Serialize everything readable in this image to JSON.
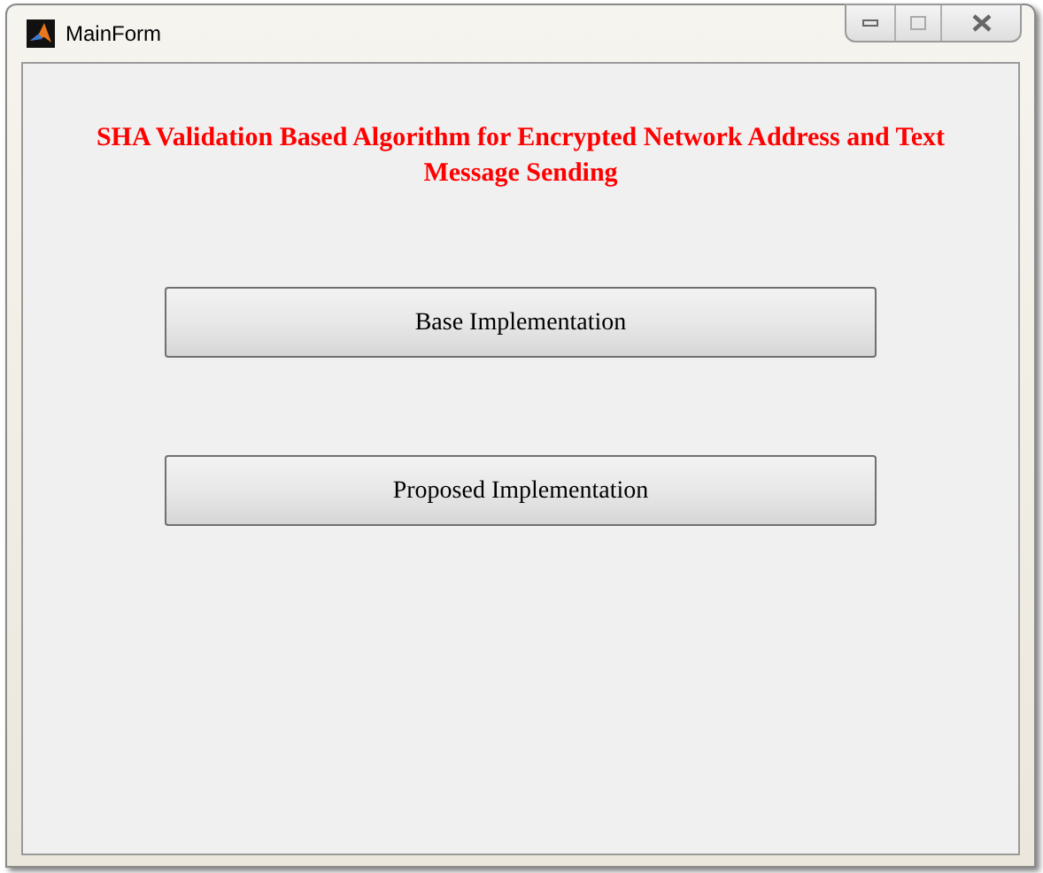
{
  "window": {
    "title": "MainForm"
  },
  "heading": "SHA Validation Based Algorithm for Encrypted Network Address and Text Message Sending",
  "buttons": [
    {
      "label": "Base Implementation"
    },
    {
      "label": "Proposed Implementation"
    }
  ]
}
